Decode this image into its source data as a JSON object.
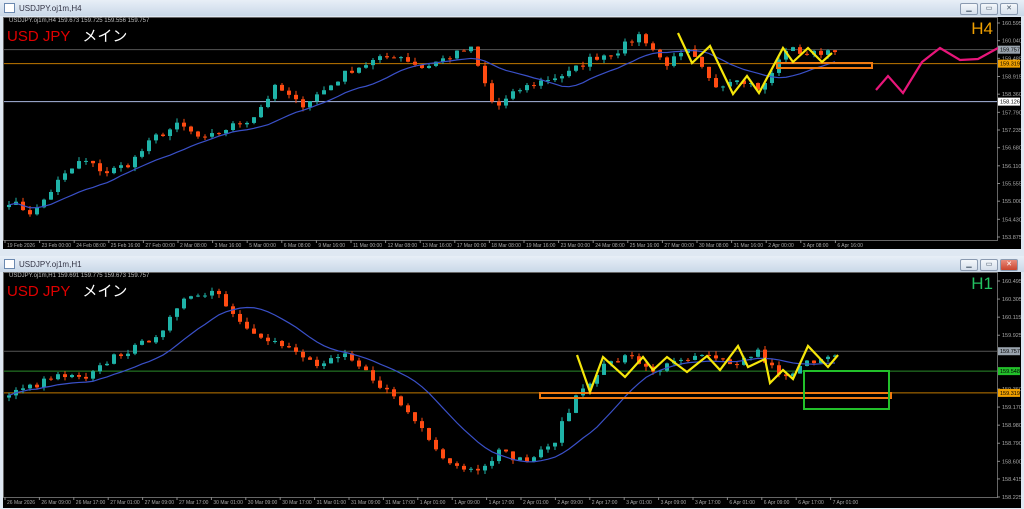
{
  "colors": {
    "up": "#1fb3a8",
    "down": "#ff4b12",
    "ma": "#3a50c8",
    "grid": "#555",
    "yellow": "#f5e60a",
    "orange": "#f07a10",
    "pink": "#e8167a",
    "green": "#22c02a"
  },
  "windows": [
    {
      "title": "USDJPY.oj1m,H4",
      "header": "USDJPY.oj1m,H4  159.673 159.725 159.556 159.757",
      "symbol": "USD JPY",
      "label": "メイン",
      "timeframe": "H4",
      "tf_color": "#f0a000",
      "buttons": {
        "minimize": "▁",
        "restore": "▭",
        "close": "✕"
      },
      "price_range": [
        153.875,
        160.595
      ],
      "price_ticks": [
        "160.595",
        "160.040",
        "159.485",
        "158.915",
        "158.360",
        "157.790",
        "157.235",
        "156.680",
        "156.110",
        "155.555",
        "155.000",
        "154.430",
        "153.875"
      ],
      "price_tags": [
        {
          "value": "159.757",
          "price": 159.757,
          "bg": "#9aa4ae",
          "line": "#555"
        },
        {
          "value": "159.319",
          "price": 159.319,
          "bg": "#f0a000",
          "line": "#c07800"
        },
        {
          "value": "158.126",
          "price": 158.126,
          "bg": "#ffffff",
          "line": "#aab8e0"
        }
      ],
      "time_ticks": [
        "19 Feb 2026",
        "23 Feb 00:00",
        "24 Feb 08:00",
        "25 Feb 16:00",
        "27 Feb 00:00",
        "2 Mar 08:00",
        "3 Mar 16:00",
        "5 Mar 00:00",
        "6 Mar 08:00",
        "9 Mar 16:00",
        "11 Mar 00:00",
        "12 Mar 08:00",
        "13 Mar 16:00",
        "17 Mar 00:00",
        "18 Mar 08:00",
        "19 Mar 16:00",
        "23 Mar 00:00",
        "24 Mar 08:00",
        "25 Mar 16:00",
        "27 Mar 00:00",
        "30 Mar 08:00",
        "31 Mar 16:00",
        "2 Apr 00:00",
        "3 Apr 08:00",
        "6 Apr 16:00"
      ],
      "price_path": [
        155.0,
        154.6,
        155.6,
        156.3,
        155.9,
        156.2,
        157.0,
        157.4,
        156.9,
        157.3,
        157.6,
        158.6,
        158.0,
        158.5,
        159.1,
        159.4,
        159.6,
        159.2,
        159.5,
        159.8,
        157.9,
        158.5,
        158.8,
        159.0,
        159.5,
        159.7,
        160.25,
        159.3,
        159.7,
        158.6,
        158.9,
        158.5,
        159.8,
        159.6,
        159.8
      ]
    },
    {
      "title": "USDJPY.oj1m,H1",
      "header": "USDJPY.oj1m,H1  159.691 159.775 159.673 159.757",
      "symbol": "USD JPY",
      "label": "メイン",
      "timeframe": "H1",
      "tf_color": "#22c060",
      "buttons": {
        "minimize": "▁",
        "restore": "▭",
        "close": "✕"
      },
      "price_range": [
        158.225,
        160.495
      ],
      "price_ticks": [
        "160.495",
        "160.305",
        "160.115",
        "159.925",
        "159.360",
        "159.170",
        "158.980",
        "158.790",
        "158.600",
        "158.415",
        "158.225"
      ],
      "price_tags": [
        {
          "value": "159.757",
          "price": 159.757,
          "bg": "#9aa4ae",
          "line": "#555"
        },
        {
          "value": "159.548",
          "price": 159.548,
          "bg": "#22c02a",
          "line": "#2a8a2a"
        },
        {
          "value": "159.319",
          "price": 159.319,
          "bg": "#f0a000",
          "line": "#c07800"
        }
      ],
      "time_ticks": [
        "26 Mar 2026",
        "26 Mar 09:00",
        "26 Mar 17:00",
        "27 Mar 01:00",
        "27 Mar 09:00",
        "27 Mar 17:00",
        "30 Mar 01:00",
        "30 Mar 09:00",
        "30 Mar 17:00",
        "31 Mar 01:00",
        "31 Mar 09:00",
        "31 Mar 17:00",
        "1 Apr 01:00",
        "1 Apr 09:00",
        "1 Apr 17:00",
        "2 Apr 01:00",
        "2 Apr 09:00",
        "2 Apr 17:00",
        "3 Apr 01:00",
        "3 Apr 09:00",
        "3 Apr 17:00",
        "6 Apr 01:00",
        "6 Apr 09:00",
        "6 Apr 17:00",
        "7 Apr 01:00"
      ],
      "price_path": [
        159.3,
        159.4,
        159.5,
        159.45,
        159.7,
        159.8,
        160.0,
        160.35,
        160.4,
        160.05,
        159.9,
        159.75,
        159.6,
        159.7,
        159.5,
        159.25,
        158.95,
        158.6,
        158.5,
        158.7,
        158.6,
        158.75,
        159.3,
        159.6,
        159.7,
        159.55,
        159.65,
        159.7,
        159.6,
        159.75,
        159.45,
        159.65,
        159.75
      ]
    }
  ]
}
